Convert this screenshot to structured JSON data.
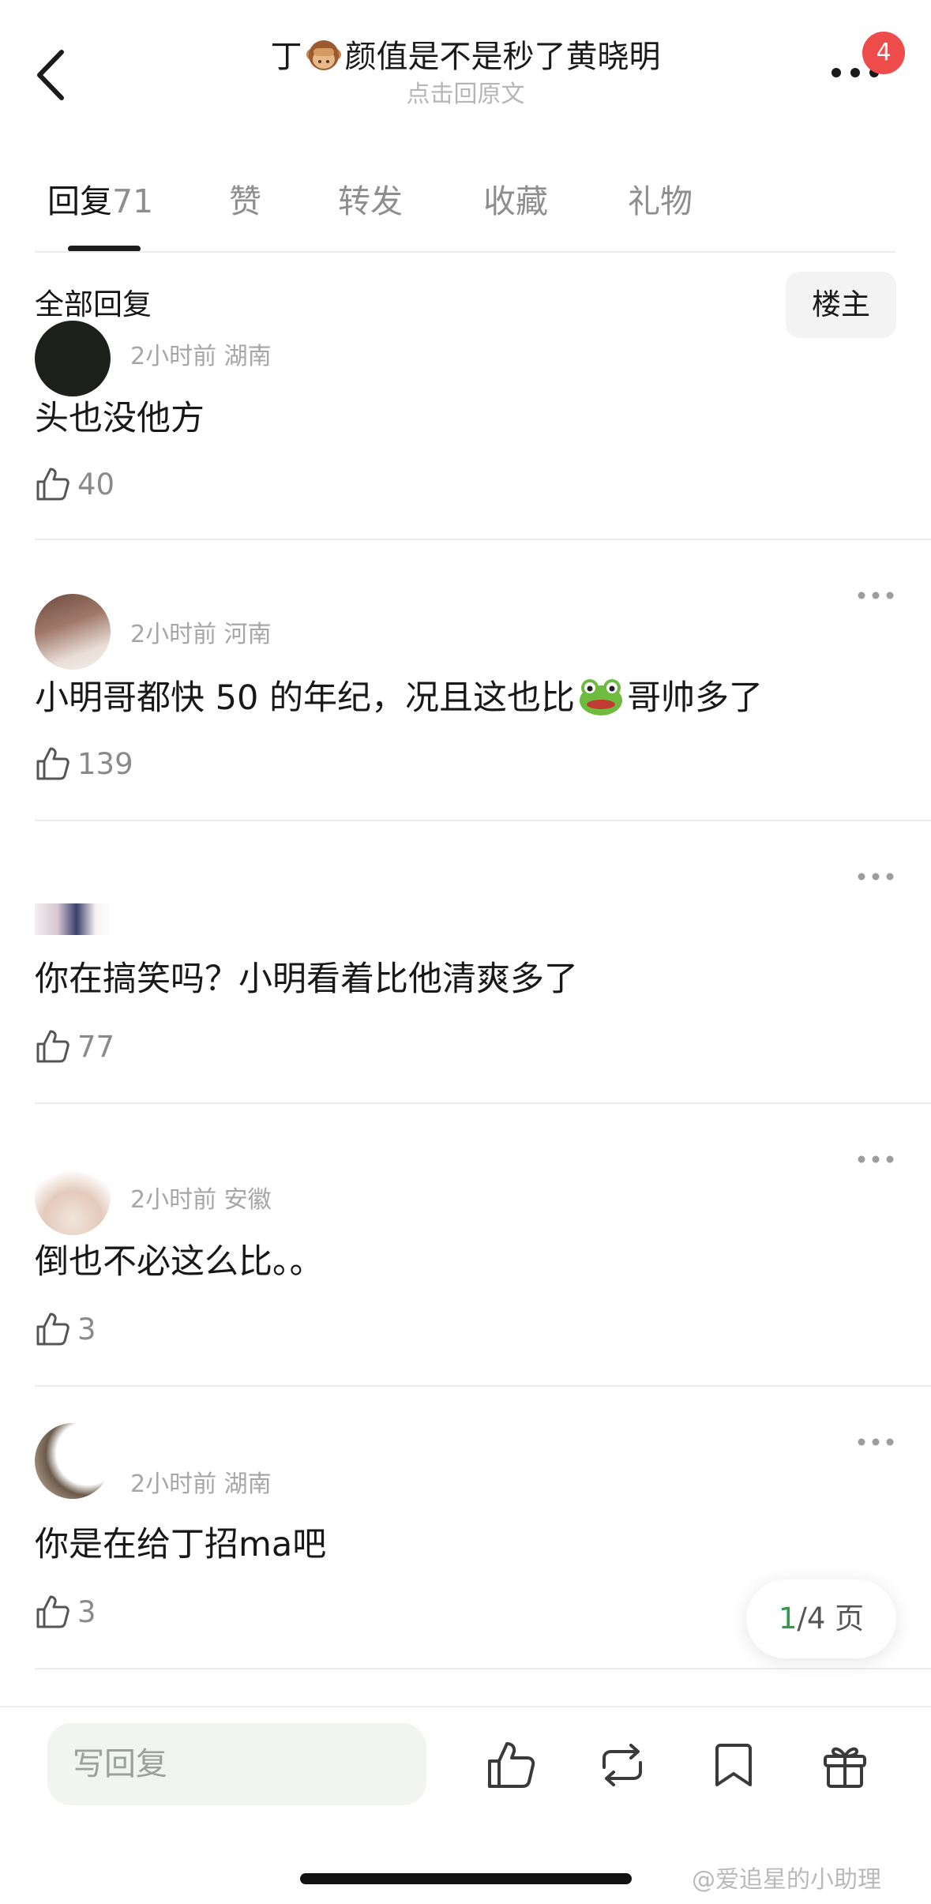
{
  "header": {
    "title_pre": "丁",
    "title_post": "颜值是不是秒了黄晓明",
    "subtitle": "点击回原文",
    "badge_count": "4",
    "title_emoji": "see-no-evil-monkey-emoji"
  },
  "tabs": [
    {
      "label": "回复",
      "count": "71",
      "active": true
    },
    {
      "label": "赞"
    },
    {
      "label": "转发"
    },
    {
      "label": "收藏"
    },
    {
      "label": "礼物"
    }
  ],
  "filter": {
    "label": "全部回复",
    "owner_button": "楼主"
  },
  "comments": [
    {
      "meta": "2小时前 湖南",
      "text": "头也没他方",
      "likes": "40"
    },
    {
      "meta": "2小时前 河南",
      "text_pre": "小明哥都快 50 的年纪，况且这也比",
      "text_emoji": "frog-emoji",
      "text_post": "哥帅多了",
      "likes": "139"
    },
    {
      "meta": "",
      "text": "你在搞笑吗？小明看着比他清爽多了",
      "likes": "77"
    },
    {
      "meta": "2小时前 安徽",
      "text": "倒也不必这么比。。",
      "likes": "3"
    },
    {
      "meta": "2小时前 湖南",
      "text": "你是在给丁招ma吧",
      "likes": "3"
    }
  ],
  "pager": {
    "current": "1",
    "total": "/4 页"
  },
  "bottom_bar": {
    "reply_placeholder": "写回复",
    "icons": [
      "like-icon",
      "repost-icon",
      "bookmark-icon",
      "gift-icon"
    ]
  },
  "watermark": "@爱追星的小助理",
  "colors": {
    "badge": "#ee4b4b",
    "pager_current": "#2f9a4a",
    "muted": "#a6a6a6"
  }
}
